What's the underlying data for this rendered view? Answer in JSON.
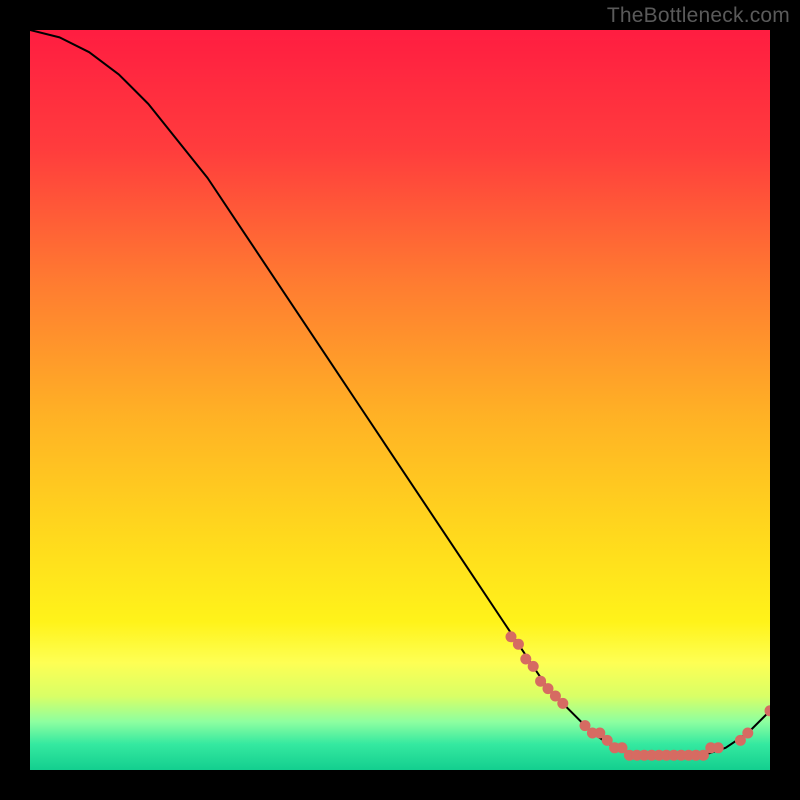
{
  "watermark": "TheBottleneck.com",
  "chart_data": {
    "type": "line",
    "title": "",
    "xlabel": "",
    "ylabel": "",
    "xlim": [
      0,
      100
    ],
    "ylim": [
      0,
      100
    ],
    "series": [
      {
        "name": "bottleneck-curve",
        "x": [
          0,
          4,
          8,
          12,
          16,
          20,
          24,
          28,
          32,
          36,
          40,
          44,
          48,
          52,
          56,
          60,
          64,
          66,
          68,
          70,
          73,
          76,
          79,
          82,
          85,
          88,
          91,
          94,
          97,
          100
        ],
        "y": [
          100,
          99,
          97,
          94,
          90,
          85,
          80,
          74,
          68,
          62,
          56,
          50,
          44,
          38,
          32,
          26,
          20,
          17,
          14,
          11,
          8,
          5,
          3,
          2,
          2,
          2,
          2,
          3,
          5,
          8
        ]
      }
    ],
    "markers": {
      "name": "highlighted-points",
      "color": "#d66b62",
      "x": [
        65,
        66,
        67,
        68,
        69,
        70,
        71,
        72,
        75,
        76,
        77,
        78,
        79,
        80,
        81,
        82,
        83,
        84,
        85,
        86,
        87,
        88,
        89,
        90,
        91,
        92,
        93,
        96,
        97,
        100
      ],
      "y": [
        18,
        17,
        15,
        14,
        12,
        11,
        10,
        9,
        6,
        5,
        5,
        4,
        3,
        3,
        2,
        2,
        2,
        2,
        2,
        2,
        2,
        2,
        2,
        2,
        2,
        3,
        3,
        4,
        5,
        8
      ]
    },
    "gradient_stops": [
      {
        "offset": 0.0,
        "color": "#ff1d41"
      },
      {
        "offset": 0.16,
        "color": "#ff3c3d"
      },
      {
        "offset": 0.34,
        "color": "#ff7b31"
      },
      {
        "offset": 0.52,
        "color": "#ffb125"
      },
      {
        "offset": 0.68,
        "color": "#ffd81d"
      },
      {
        "offset": 0.8,
        "color": "#fff31a"
      },
      {
        "offset": 0.855,
        "color": "#feff54"
      },
      {
        "offset": 0.9,
        "color": "#d9ff66"
      },
      {
        "offset": 0.935,
        "color": "#8dffa0"
      },
      {
        "offset": 0.965,
        "color": "#35e9a0"
      },
      {
        "offset": 1.0,
        "color": "#13cf8f"
      }
    ]
  }
}
